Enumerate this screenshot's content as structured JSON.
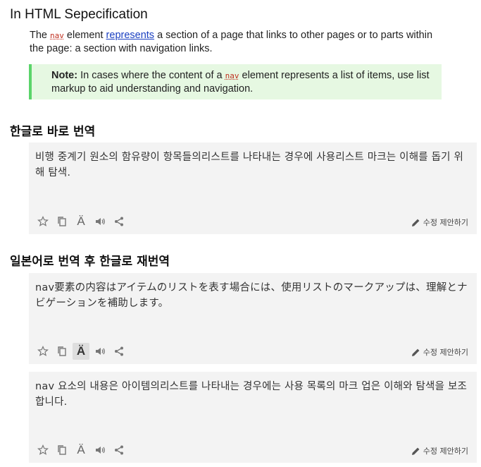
{
  "spec": {
    "heading": "In HTML Sepecification",
    "para_pre": "The ",
    "para_code": "nav",
    "para_mid": " element ",
    "para_link": "represents",
    "para_post": " a section of a page that links to other pages or to parts within the page: a section with navigation links.",
    "note_label": "Note:",
    "note_pre": " In cases where the content of a ",
    "note_code": "nav",
    "note_post": " element represents a list of items, use list markup to aid understanding and navigation."
  },
  "direct": {
    "heading": "한글로 바로 번역",
    "text": "비행 중계기 원소의 함유량이 항목들의리스트를 나타내는 경우에 사용리스트 마크는 이해를 돕기 위해 탐색.",
    "suggest_label": "수정 제안하기"
  },
  "retrans": {
    "heading": "일본어로 번역 후 한글로 재번역",
    "ja_text": "nav要素の内容はアイテムのリストを表す場合には、使用リストのマークアップは、理解とナビゲーションを補助します。",
    "ko_text": "nav 요소의 내용은 아이템의리스트를 나타내는 경우에는 사용 목록의 마크 업은 이해와 탐색을 보조합니다.",
    "suggest_label": "수정 제안하기"
  },
  "toolbar_icons": [
    "star-icon",
    "copy-icon",
    "pronunciation-icon",
    "speaker-icon",
    "share-icon"
  ],
  "colors": {
    "note_bg": "#e6f8e2",
    "note_border": "#5bd46a",
    "card_bg": "#f3f3f3",
    "link": "#1a3fc1",
    "code": "#c03020"
  }
}
